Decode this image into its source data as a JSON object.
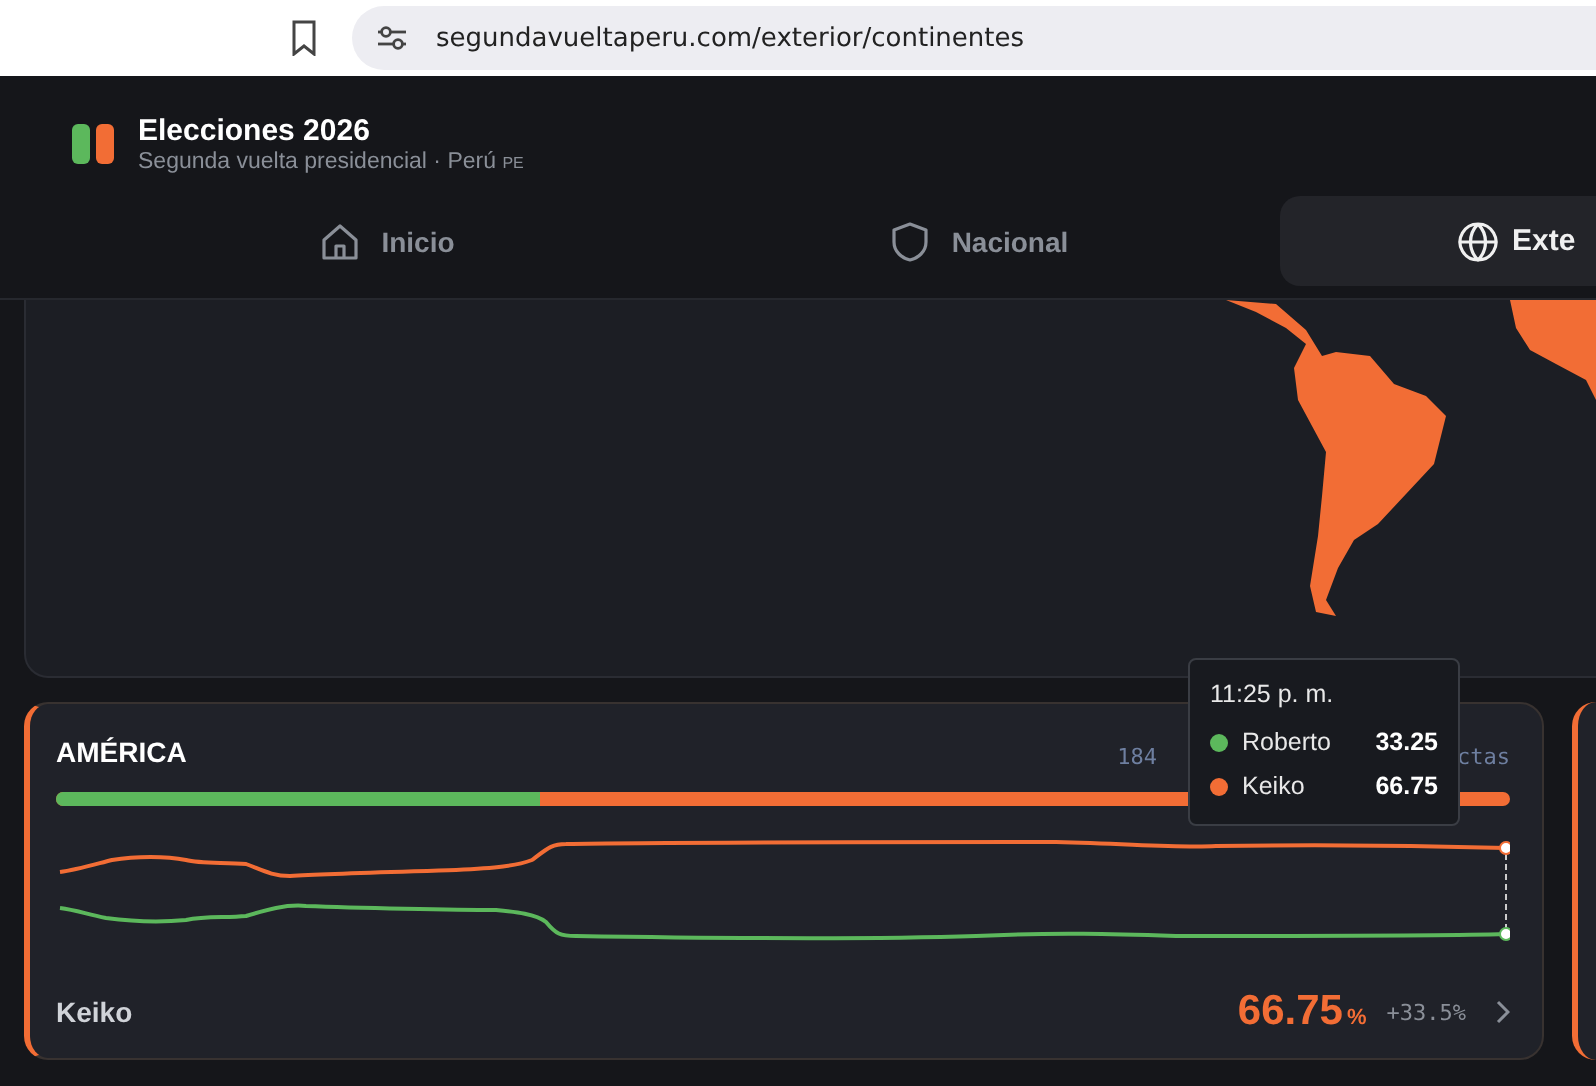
{
  "browser": {
    "url": "segundavueltaperu.com/exterior/continentes"
  },
  "header": {
    "title": "Elecciones 2026",
    "subtitle": "Segunda vuelta presidencial · Perú",
    "country_code": "PE"
  },
  "tabs": [
    {
      "label": "Inicio",
      "selected": false
    },
    {
      "label": "Nacional",
      "selected": false
    },
    {
      "label": "Exte",
      "selected": true
    }
  ],
  "map": {
    "kind": "map"
  },
  "region_card": {
    "title": "AMÉRICA",
    "counter_fragments": [
      "184",
      "ctas"
    ],
    "vote_bar": {
      "level": 0.3325
    },
    "leader": "Keiko",
    "percent": "66.75",
    "percent_sign": "%",
    "margin": "+33.5%"
  },
  "tooltip": {
    "time": "11:25 p. m.",
    "rows": [
      {
        "name": "Roberto",
        "value": "33.25",
        "color": "#5cb85c"
      },
      {
        "name": "Keiko",
        "value": "66.75",
        "color": "#f26d35"
      }
    ]
  }
}
